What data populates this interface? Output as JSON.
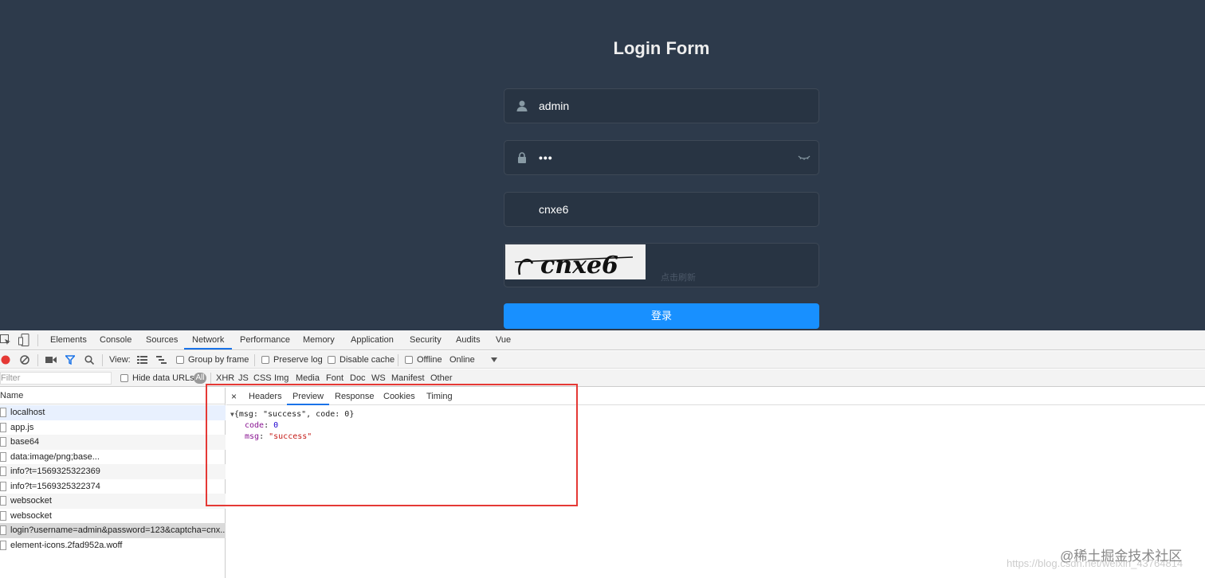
{
  "login": {
    "title": "Login Form",
    "username_value": "admin",
    "password_mask": "•••",
    "captcha_value": "cnxe6",
    "captcha_image_text": "cnxe6",
    "captcha_hint": "点击刷新",
    "submit_label": "登录"
  },
  "devtools": {
    "tabs": [
      "Elements",
      "Console",
      "Sources",
      "Network",
      "Performance",
      "Memory",
      "Application",
      "Security",
      "Audits",
      "Vue"
    ],
    "active_tab": "Network",
    "toolbar": {
      "view_label": "View:",
      "group_by_frame": "Group by frame",
      "preserve_log": "Preserve log",
      "disable_cache": "Disable cache",
      "offline": "Offline",
      "throttle": "Online"
    },
    "filter": {
      "placeholder": "Filter",
      "hide_data_urls": "Hide data URLs",
      "all": "All",
      "types": [
        "XHR",
        "JS",
        "CSS",
        "Img",
        "Media",
        "Font",
        "Doc",
        "WS",
        "Manifest",
        "Other"
      ]
    },
    "requests": {
      "header": "Name",
      "rows": [
        "localhost",
        "app.js",
        "base64",
        "data:image/png;base...",
        "info?t=1569325322369",
        "info?t=1569325322374",
        "websocket",
        "websocket",
        "login?username=admin&password=123&captcha=cnx...",
        "element-icons.2fad952a.woff"
      ]
    },
    "detail": {
      "close": "×",
      "tabs": [
        "Headers",
        "Preview",
        "Response",
        "Cookies",
        "Timing"
      ],
      "active_tab": "Preview",
      "preview_summary": "{msg: \"success\", code: 0}",
      "code_key": "code",
      "code_value": "0",
      "msg_key": "msg",
      "msg_value": "\"success\""
    }
  },
  "watermark": "https://blog.csdn.net/weixin_43764814",
  "juejin_watermark": "@稀土掘金技术社区"
}
